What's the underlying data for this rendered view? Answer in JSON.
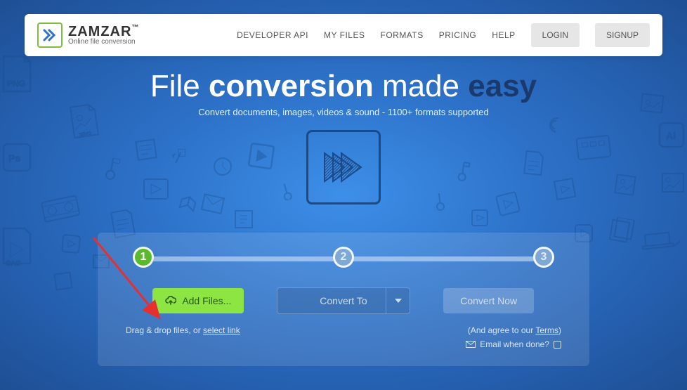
{
  "brand": {
    "name": "ZAMZAR",
    "tagline": "Online file conversion",
    "tm": "™"
  },
  "nav": {
    "developer": "DEVELOPER API",
    "myfiles": "MY FILES",
    "formats": "FORMATS",
    "pricing": "PRICING",
    "help": "HELP",
    "login": "LOGIN",
    "signup": "SIGNUP"
  },
  "hero": {
    "t1": "File ",
    "t2": "conversion",
    "t3": " made ",
    "t4": "easy",
    "sub": "Convert documents, images, videos & sound - 1100+ formats supported"
  },
  "steps": {
    "s1": "1",
    "s2": "2",
    "s3": "3"
  },
  "actions": {
    "add_files": "Add Files...",
    "convert_to": "Convert To",
    "convert_now": "Convert Now"
  },
  "sub": {
    "drag_prefix": "Drag & drop files, or ",
    "select_link": "select link",
    "agree_prefix": "(And agree to our ",
    "terms": "Terms",
    "agree_suffix": ")",
    "email_done": "Email when done?"
  }
}
